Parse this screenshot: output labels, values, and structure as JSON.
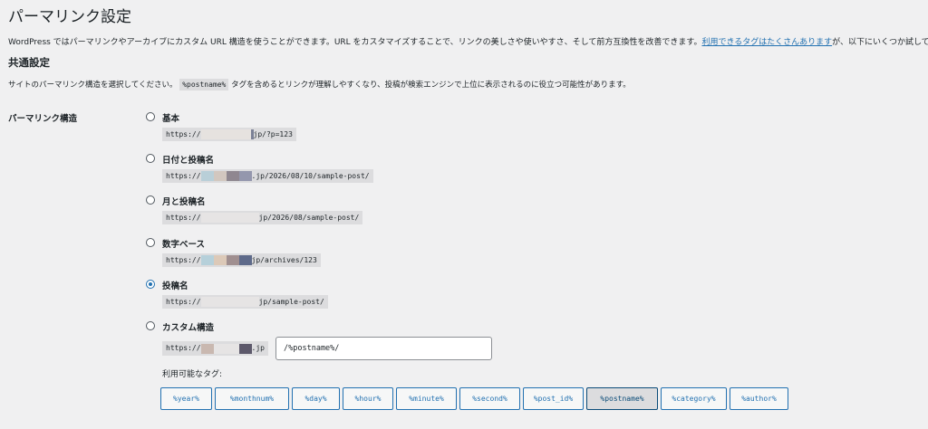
{
  "page": {
    "title": "パーマリンク設定",
    "intro": "WordPress ではパーマリンクやアーカイブにカスタム URL 構造を使うことができます。URL をカスタマイズすることで、リンクの美しさや使いやすさ、そして前方互換性を改善できます。",
    "intro_link": "利用できるタグはたくさんあります",
    "intro_after": "が、以下にいくつか試してい"
  },
  "common": {
    "title": "共通設定",
    "desc_before": "サイトのパーマリンク構造を選択してください。",
    "desc_code": "%postname%",
    "desc_after": "タグを含めるとリンクが理解しやすくなり、投稿が検索エンジンで上位に表示されるのに役立つ可能性があります。"
  },
  "structure": {
    "label": "パーマリンク構造",
    "options": [
      {
        "label": "基本",
        "prefix": "https://",
        "suffix": "jp/?p=123",
        "checked": false
      },
      {
        "label": "日付と投稿名",
        "prefix": "https://",
        "suffix": ".jp/2026/08/10/sample-post/",
        "checked": false
      },
      {
        "label": "月と投稿名",
        "prefix": "https://",
        "suffix": "jp/2026/08/sample-post/",
        "checked": false
      },
      {
        "label": "数字ベース",
        "prefix": "https://",
        "suffix": "jp/archives/123",
        "checked": false
      },
      {
        "label": "投稿名",
        "prefix": "https://",
        "suffix": "jp/sample-post/",
        "checked": true
      },
      {
        "label": "カスタム構造",
        "prefix": "https://",
        "suffix": ".jp",
        "checked": false
      }
    ],
    "custom_value": "/%postname%/",
    "tags_label": "利用可能なタグ:",
    "tags": [
      "%year%",
      "%monthnum%",
      "%day%",
      "%hour%",
      "%minute%",
      "%second%",
      "%post_id%",
      "%postname%",
      "%category%",
      "%author%"
    ],
    "active_tag": "%postname%"
  },
  "colors": {
    "accent": "#2271b1",
    "background": "#f0f0f1",
    "code_bg": "#dcdcde"
  }
}
